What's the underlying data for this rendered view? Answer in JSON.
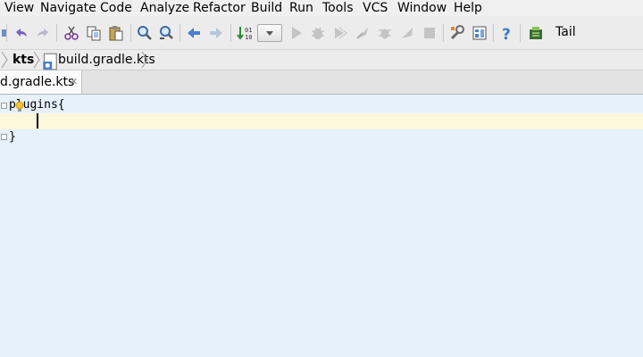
{
  "menu": [
    "View",
    "Navigate",
    "Code",
    "Analyze",
    "Refactor",
    "Build",
    "Run",
    "Tools",
    "VCS",
    "Window",
    "Help"
  ],
  "toolbar": {
    "tail_label": "Tail",
    "icons": [
      "undo-icon",
      "redo-icon",
      "cut-icon",
      "copy-icon",
      "paste-icon",
      "find-icon",
      "replace-icon",
      "back-icon",
      "forward-icon",
      "make-project-icon",
      "run-icon",
      "debug-icon",
      "coverage-icon",
      "profile-icon",
      "attach-icon",
      "deploy-icon",
      "stop-icon",
      "settings-icon",
      "project-structure-icon",
      "help-icon",
      "sdk-manager-icon"
    ]
  },
  "breadcrumb": {
    "items": [
      "kts",
      "build.gradle.kts"
    ]
  },
  "tabs": [
    {
      "label": "d.gradle.kts",
      "close": "✕"
    }
  ],
  "editor": {
    "lines": [
      "plugins{",
      "    ",
      "}"
    ]
  },
  "colors": {
    "editor_bg": "#e6f1fc",
    "current_line": "#fdf7dc",
    "accent_blue": "#4a7fd1",
    "toolbar_bg": "#ececec"
  }
}
